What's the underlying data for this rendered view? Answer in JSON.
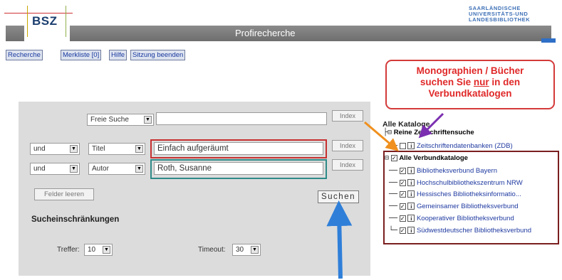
{
  "header": {
    "logo": "BSZ",
    "title": "Profirecherche",
    "partner_logo_lines": [
      "SAARLÄNDISCHE",
      "UNIVERSITÄTS-UND",
      "LANDESBIBLIOTHEK"
    ]
  },
  "nav": {
    "items": [
      "Recherche",
      "Merkliste [0]",
      "Hilfe",
      "Sitzung beenden"
    ]
  },
  "callout": {
    "line1": "Monographien / Bücher",
    "line2_pre": "suchen Sie ",
    "line2_em": "nur",
    "line2_post": " in den",
    "line3": "Verbundkatalogen"
  },
  "search": {
    "row1": {
      "field": "Freie Suche",
      "value": "",
      "index": "Index"
    },
    "row2": {
      "op": "und",
      "field": "Titel",
      "value": "Einfach aufgeräumt",
      "index": "Index"
    },
    "row3": {
      "op": "und",
      "field": "Autor",
      "value": "Roth, Susanne",
      "index": "Index"
    },
    "clear_label": "Felder leeren",
    "submit_label": "Suchen",
    "restrictions_title": "Sucheinschränkungen",
    "hits_label": "Treffer:",
    "hits_value": "10",
    "timeout_label": "Timeout:",
    "timeout_value": "30"
  },
  "catalogs": {
    "title": "Alle Kataloge",
    "group1": {
      "label": "Reine Zeitschriftensuche",
      "items": [
        {
          "label": "Zeitschriftendatenbanken (ZDB)",
          "checked": false
        }
      ]
    },
    "group2": {
      "label": "Alle Verbundkataloge",
      "checked": true,
      "items": [
        {
          "label": "Bibliotheksverbund Bayern",
          "checked": true
        },
        {
          "label": "Hochschulbibliothekszentrum NRW",
          "checked": true
        },
        {
          "label": "Hessisches Bibliotheksinformatio...",
          "checked": true
        },
        {
          "label": "Gemeinsamer Bibliotheksverbund",
          "checked": true
        },
        {
          "label": "Kooperativer Bibliotheksverbund",
          "checked": true
        },
        {
          "label": "Südwestdeutscher Bibliotheksverbund",
          "checked": true
        }
      ]
    }
  },
  "colors": {
    "callout_red": "#e02828",
    "arrow_blue": "#2f7fd9",
    "arrow_orange": "#f0901e",
    "arrow_purple": "#7b2fb0",
    "link_blue": "#1f3aa0",
    "header_grey": "#7a7a7a"
  }
}
